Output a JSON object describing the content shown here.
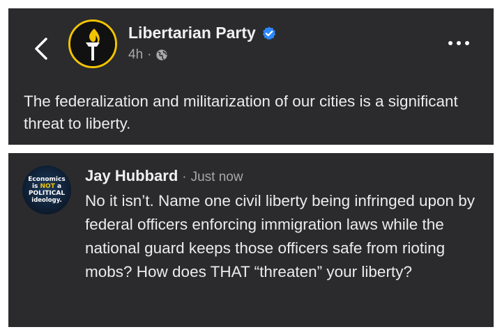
{
  "post": {
    "page_name": "Libertarian Party",
    "verified": true,
    "time": "4h",
    "separator": "·",
    "audience_icon": "globe-icon",
    "text": "The federalization and militarization of our cities is a significant threat to liberty."
  },
  "comment": {
    "author": "Jay Hubbard",
    "separator": "·",
    "time": "Just now",
    "text": "No it isn’t. Name one civil liberty being infringed upon by federal officers enforcing immigration laws while the national guard keeps those officers safe from rioting mobs? How does THAT “threaten” your liberty?",
    "avatar_text": {
      "line1": "Economics",
      "line2_pre": "is ",
      "line2_accent": "NOT",
      "line2_post": " a",
      "line3": "POLITICAL",
      "line4": "ideology."
    }
  },
  "icons": {
    "back": "chevron-left-icon",
    "more": "more-horizontal-icon",
    "verified": "verified-badge-icon",
    "page_logo": "torch-logo"
  },
  "colors": {
    "card_bg": "#2b2b2d",
    "verified_blue": "#2d88ff",
    "logo_gold": "#f2c400",
    "secondary_text": "#a8a8ab"
  }
}
